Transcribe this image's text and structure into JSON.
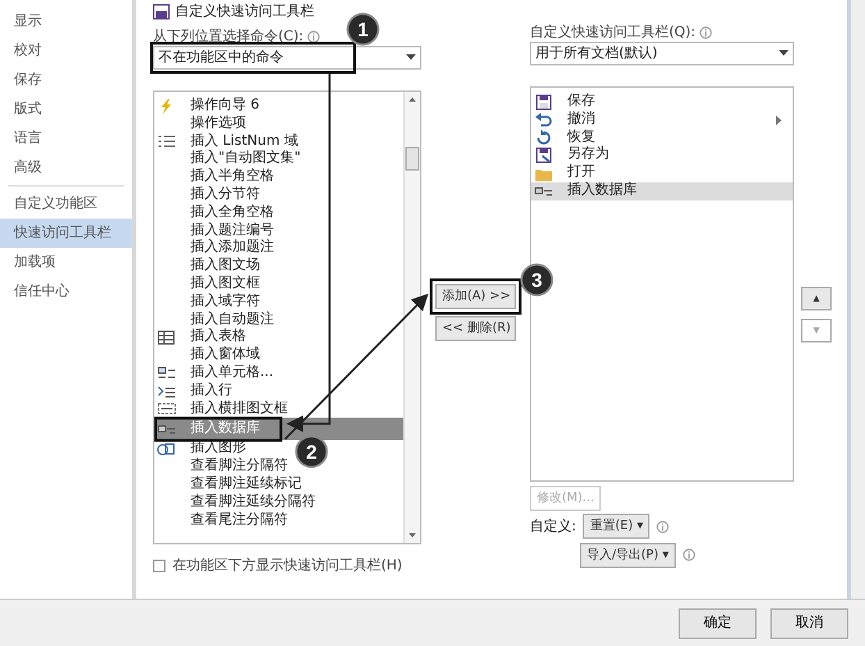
{
  "sidebar": {
    "items": [
      {
        "label": "显示",
        "selected": false
      },
      {
        "label": "校对",
        "selected": false
      },
      {
        "label": "保存",
        "selected": false
      },
      {
        "label": "版式",
        "selected": false
      },
      {
        "label": "语言",
        "selected": false
      },
      {
        "label": "高级",
        "selected": false
      },
      {
        "label": "自定义功能区",
        "selected": false
      },
      {
        "label": "快速访问工具栏",
        "selected": true
      },
      {
        "label": "加载项",
        "selected": false
      },
      {
        "label": "信任中心",
        "selected": false
      }
    ]
  },
  "page_title": "自定义快速访问工具栏",
  "commands": {
    "label": "从下列位置选择命令(C):",
    "dropdown": "不在功能区中的命令",
    "items": [
      {
        "label": "操作向导 6",
        "kind": "lightning",
        "selected": false
      },
      {
        "label": "操作选项",
        "selected": false
      },
      {
        "label": "插入 ListNum 域",
        "kind": "list",
        "selected": false
      },
      {
        "label": "插入\"自动图文集\"",
        "selected": false
      },
      {
        "label": "插入半角空格",
        "selected": false
      },
      {
        "label": "插入分节符",
        "selected": false
      },
      {
        "label": "插入全角空格",
        "selected": false
      },
      {
        "label": "插入题注编号",
        "selected": false
      },
      {
        "label": "插入添加题注",
        "selected": false
      },
      {
        "label": "插入图文场",
        "selected": false
      },
      {
        "label": "插入图文框",
        "selected": false
      },
      {
        "label": "插入域字符",
        "selected": false
      },
      {
        "label": "插入自动题注",
        "selected": false
      },
      {
        "label": "插入表格",
        "kind": "table",
        "selected": false
      },
      {
        "label": "插入窗体域",
        "selected": false
      },
      {
        "label": "插入单元格...",
        "kind": "cells",
        "selected": false
      },
      {
        "label": "插入行",
        "kind": "rows",
        "selected": false
      },
      {
        "label": "插入横排图文框",
        "kind": "textbox",
        "selected": false
      },
      {
        "label": "插入数据库",
        "kind": "database",
        "selected": true
      },
      {
        "label": "插入图形",
        "kind": "shape",
        "selected": false
      },
      {
        "label": "查看脚注分隔符",
        "selected": false
      },
      {
        "label": "查看脚注延续标记",
        "selected": false
      },
      {
        "label": "查看脚注延续分隔符",
        "selected": false
      },
      {
        "label": "查看尾注分隔符",
        "selected": false
      }
    ]
  },
  "add_button": "添加(A) >>",
  "remove_button": "<< 删除(R)",
  "toolbar": {
    "label": "自定义快速访问工具栏(Q):",
    "dropdown": "用于所有文档(默认)",
    "items": [
      {
        "label": "保存",
        "kind": "save",
        "selected": false
      },
      {
        "label": "撤消",
        "kind": "undo",
        "submenu": true,
        "selected": false
      },
      {
        "label": "恢复",
        "kind": "redo",
        "selected": false
      },
      {
        "label": "另存为",
        "kind": "saveas",
        "selected": false
      },
      {
        "label": "打开",
        "kind": "folder",
        "selected": false
      },
      {
        "label": "插入数据库",
        "kind": "database",
        "selected": true
      }
    ]
  },
  "move_up": "▲",
  "move_down": "▼",
  "modify_button": {
    "label": "修改(M)...",
    "disabled": true
  },
  "customize_label": "自定义:",
  "reset_button": "重置(E) ▾",
  "import_export_button": "导入/导出(P) ▾",
  "show_below_ribbon": {
    "label": "在功能区下方显示快速访问工具栏(H)",
    "checked": false
  },
  "footer_buttons": [
    "确定",
    "取消"
  ],
  "annotations": [
    {
      "number": "1"
    },
    {
      "number": "2"
    },
    {
      "number": "3"
    }
  ]
}
